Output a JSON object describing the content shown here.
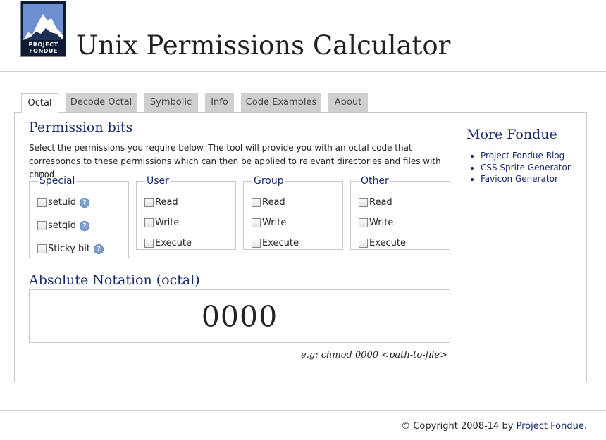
{
  "header": {
    "logo_text": [
      "PROJECT",
      "FONDUE"
    ],
    "title": "Unix Permissions Calculator"
  },
  "tabs": [
    {
      "label": "Octal",
      "active": true
    },
    {
      "label": "Decode Octal",
      "active": false
    },
    {
      "label": "Symbolic",
      "active": false
    },
    {
      "label": "Info",
      "active": false
    },
    {
      "label": "Code Examples",
      "active": false
    },
    {
      "label": "About",
      "active": false
    }
  ],
  "main": {
    "heading": "Permission bits",
    "intro": "Select the permissions you require below. The tool will provide you with an octal code that corresponds to these permissions which can then be applied to relevant directories and files with",
    "intro_code": "chmod",
    "intro_end": ".",
    "groups": {
      "special": {
        "legend": "Special",
        "options": [
          "setuid",
          "setgid",
          "Sticky bit"
        ],
        "help_icon": "?"
      },
      "user": {
        "legend": "User",
        "options": [
          "Read",
          "Write",
          "Execute"
        ]
      },
      "group": {
        "legend": "Group",
        "options": [
          "Read",
          "Write",
          "Execute"
        ]
      },
      "other": {
        "legend": "Other",
        "options": [
          "Read",
          "Write",
          "Execute"
        ]
      }
    },
    "result_heading": "Absolute Notation (octal)",
    "octal_value": "0000",
    "example": "e.g: chmod 0000 <path-to-file>"
  },
  "sidebar": {
    "heading": "More Fondue",
    "links": [
      "Project Fondue Blog",
      "CSS Sprite Generator",
      "Favicon Generator"
    ]
  },
  "footer": {
    "copyright": "© Copyright 2008-14 by",
    "link": "Project Fondue",
    "end": "."
  },
  "colors": {
    "accent": "#1a2a6c",
    "tab_inactive": "#cfcfcf",
    "border": "#c8c8c8"
  },
  "icons": {
    "help": "help-icon",
    "logo": "mountain-logo"
  }
}
